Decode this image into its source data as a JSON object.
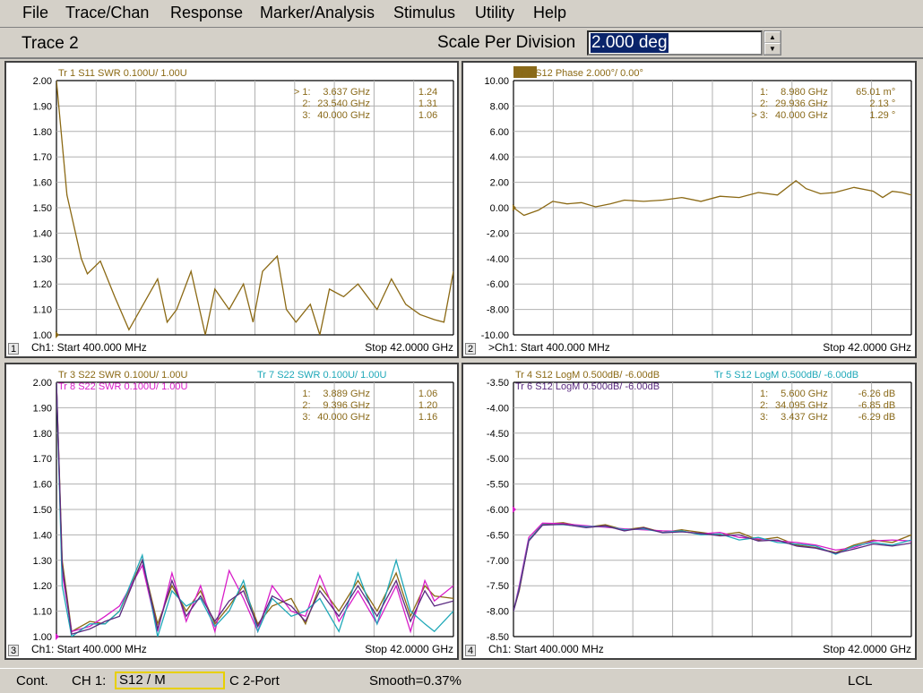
{
  "menu": [
    "File",
    "Trace/Chan",
    "Response",
    "Marker/Analysis",
    "Stimulus",
    "Utility",
    "Help"
  ],
  "entry": {
    "title": "Trace 2",
    "label": "Scale Per Division",
    "value": "2.000 deg",
    "sel": "2.000 deg",
    "spin_up": "▲",
    "spin_down": "▼"
  },
  "colors": {
    "gold": "#8b6914",
    "cyan": "#1ea8b8",
    "magenta": "#d81cc8",
    "purple": "#5a2a80",
    "brown": "#8a6a1a"
  },
  "windows": [
    {
      "id": 1,
      "headers": [
        {
          "text": "Tr  1  S11 SWR 0.100U/  1.00U",
          "color": "gold",
          "boxed": false
        }
      ],
      "yticks": [
        "2.00",
        "1.90",
        "1.80",
        "1.70",
        "1.60",
        "1.50",
        "1.40",
        "1.30",
        "1.20",
        "1.10",
        "1.00"
      ],
      "yrange": [
        1.0,
        2.0
      ],
      "markers_table": [
        [
          "> 1:",
          "3.637 GHz",
          "1.24"
        ],
        [
          "2:",
          "23.540 GHz",
          "1.31"
        ],
        [
          "3:",
          "40.000 GHz",
          "1.06"
        ]
      ],
      "start": "Ch1: Start  400.000 MHz",
      "stop": "Stop  42.0000 GHz",
      "num": "1",
      "chart_data": {
        "type": "line",
        "x_range_ghz": [
          0.4,
          42.0
        ],
        "ylim": [
          1.0,
          2.0
        ],
        "series": [
          {
            "color": "gold",
            "x": [
              0.4,
              1.5,
              3.0,
              3.637,
              5,
              6.5,
              8,
              9.5,
              11,
              12,
              13,
              14.5,
              16,
              17,
              18.5,
              20,
              21,
              22,
              23.54,
              24.5,
              25.5,
              27,
              28,
              29,
              30.5,
              32,
              34,
              35.5,
              37,
              38.5,
              40,
              41,
              42
            ],
            "y": [
              2.0,
              1.55,
              1.3,
              1.24,
              1.29,
              1.15,
              1.02,
              1.12,
              1.22,
              1.05,
              1.1,
              1.25,
              1.0,
              1.18,
              1.1,
              1.2,
              1.05,
              1.25,
              1.31,
              1.1,
              1.05,
              1.12,
              1.0,
              1.18,
              1.15,
              1.2,
              1.1,
              1.22,
              1.12,
              1.08,
              1.06,
              1.05,
              1.25
            ]
          }
        ]
      }
    },
    {
      "id": 2,
      "headers": [
        {
          "text": "Tr  2  S12 Phase 2.000°/  0.00°",
          "color": "gold",
          "boxed": true
        }
      ],
      "yticks": [
        "10.00",
        "8.00",
        "6.00",
        "4.00",
        "2.00",
        "0.00",
        "-2.00",
        "-4.00",
        "-6.00",
        "-8.00",
        "-10.00"
      ],
      "yrange": [
        -10,
        10
      ],
      "markers_table": [
        [
          "1:",
          "8.980 GHz",
          "65.01 m°"
        ],
        [
          "2:",
          "29.936 GHz",
          "2.13 °"
        ],
        [
          "> 3:",
          "40.000 GHz",
          "1.29 °"
        ]
      ],
      "start": ">Ch1: Start  400.000 MHz",
      "stop": "Stop  42.0000 GHz",
      "num": "2",
      "chart_data": {
        "type": "line",
        "x_range_ghz": [
          0.4,
          42.0
        ],
        "ylim": [
          -10,
          10
        ],
        "series": [
          {
            "color": "gold",
            "x": [
              0.4,
              1.5,
              3,
              4.5,
              6,
              7.5,
              8.98,
              10.5,
              12,
              14,
              16,
              18,
              20,
              22,
              24,
              26,
              28,
              29.936,
              31,
              32.5,
              34,
              36,
              38,
              39,
              40,
              41,
              42
            ],
            "y": [
              0.0,
              -0.6,
              -0.2,
              0.5,
              0.3,
              0.4,
              0.07,
              0.3,
              0.6,
              0.5,
              0.6,
              0.8,
              0.5,
              0.9,
              0.8,
              1.2,
              1.0,
              2.13,
              1.5,
              1.1,
              1.2,
              1.6,
              1.3,
              0.8,
              1.29,
              1.2,
              1.0
            ]
          }
        ]
      }
    },
    {
      "id": 3,
      "headers": [
        {
          "text": "Tr  3  S22 SWR 0.100U/  1.00U",
          "color": "gold",
          "boxed": false
        },
        {
          "text": "Tr  8  S22 SWR 0.100U/  1.00U",
          "color": "magenta",
          "boxed": false
        },
        {
          "text": "Tr  7  S22 SWR 0.100U/  1.00U",
          "color": "cyan",
          "boxed": false
        }
      ],
      "yticks": [
        "2.00",
        "1.90",
        "1.80",
        "1.70",
        "1.60",
        "1.50",
        "1.40",
        "1.30",
        "1.20",
        "1.10",
        "1.00"
      ],
      "yrange": [
        1.0,
        2.0
      ],
      "markers_table": [
        [
          "1:",
          "3.889 GHz",
          "1.06"
        ],
        [
          "2:",
          "9.396 GHz",
          "1.20"
        ],
        [
          "3:",
          "40.000 GHz",
          "1.16"
        ]
      ],
      "start": "Ch1: Start  400.000 MHz",
      "stop": "Stop  42.0000 GHz",
      "num": "3",
      "chart_data": {
        "type": "line",
        "x_range_ghz": [
          0.4,
          42.0
        ],
        "ylim": [
          1.0,
          2.0
        ],
        "series": [
          {
            "color": "gold",
            "x": [
              0.4,
              1,
              2,
              3.889,
              5.5,
              7,
              9.396,
              11,
              12.5,
              14,
              15.5,
              17,
              18.5,
              20,
              21.5,
              23,
              25,
              26.5,
              28,
              30,
              32,
              34,
              36,
              37.5,
              39,
              40,
              42
            ],
            "y": [
              2.0,
              1.3,
              1.02,
              1.06,
              1.05,
              1.1,
              1.3,
              1.05,
              1.2,
              1.1,
              1.18,
              1.05,
              1.12,
              1.2,
              1.05,
              1.12,
              1.15,
              1.05,
              1.2,
              1.1,
              1.22,
              1.1,
              1.25,
              1.08,
              1.2,
              1.16,
              1.15
            ]
          },
          {
            "color": "magenta",
            "x": [
              0.4,
              1,
              2,
              3.889,
              5.5,
              7,
              9.396,
              11,
              12.5,
              14,
              15.5,
              17,
              18.5,
              20,
              21.5,
              23,
              25,
              26.5,
              28,
              30,
              32,
              34,
              36,
              37.5,
              39,
              40,
              42
            ],
            "y": [
              2.0,
              1.25,
              1.02,
              1.04,
              1.08,
              1.12,
              1.28,
              1.02,
              1.25,
              1.06,
              1.2,
              1.02,
              1.26,
              1.15,
              1.02,
              1.2,
              1.1,
              1.08,
              1.24,
              1.06,
              1.18,
              1.05,
              1.2,
              1.02,
              1.22,
              1.14,
              1.2
            ]
          },
          {
            "color": "cyan",
            "x": [
              0.4,
              1,
              2,
              3.889,
              5.5,
              7,
              9.396,
              11,
              12.5,
              14,
              15.5,
              17,
              18.5,
              20,
              21.5,
              23,
              25,
              26.5,
              28,
              30,
              32,
              34,
              36,
              37.5,
              39,
              40,
              42
            ],
            "y": [
              2.0,
              1.2,
              1.0,
              1.05,
              1.05,
              1.1,
              1.32,
              1.0,
              1.18,
              1.12,
              1.15,
              1.04,
              1.1,
              1.22,
              1.02,
              1.15,
              1.08,
              1.1,
              1.15,
              1.02,
              1.25,
              1.05,
              1.3,
              1.1,
              1.05,
              1.02,
              1.1
            ]
          },
          {
            "color": "purple",
            "x": [
              0.4,
              1,
              2,
              3.889,
              5.5,
              7,
              9.396,
              11,
              12.5,
              14,
              15.5,
              17,
              18.5,
              20,
              21.5,
              23,
              25,
              26.5,
              28,
              30,
              32,
              34,
              36,
              37.5,
              39,
              40,
              42
            ],
            "y": [
              2.0,
              1.28,
              1.01,
              1.03,
              1.06,
              1.08,
              1.3,
              1.03,
              1.22,
              1.08,
              1.16,
              1.06,
              1.14,
              1.18,
              1.04,
              1.16,
              1.12,
              1.06,
              1.18,
              1.08,
              1.2,
              1.08,
              1.22,
              1.06,
              1.18,
              1.12,
              1.14
            ]
          }
        ]
      }
    },
    {
      "id": 4,
      "headers": [
        {
          "text": "Tr  4  S12 LogM 0.500dB/  -6.00dB",
          "color": "gold",
          "boxed": false
        },
        {
          "text": "Tr  6  S12 LogM 0.500dB/  -6.00dB",
          "color": "purple",
          "boxed": false
        },
        {
          "text": "Tr  5  S12 LogM 0.500dB/  -6.00dB",
          "color": "cyan",
          "boxed": false
        }
      ],
      "yticks": [
        "-3.50",
        "-4.00",
        "-4.50",
        "-5.00",
        "-5.50",
        "-6.00",
        "-6.50",
        "-7.00",
        "-7.50",
        "-8.00",
        "-8.50"
      ],
      "yrange": [
        -8.5,
        -3.5
      ],
      "markers_table": [
        [
          "1:",
          "5.600 GHz",
          "-6.26 dB"
        ],
        [
          "2:",
          "34.095 GHz",
          "-6.85 dB"
        ],
        [
          "3:",
          "3.437 GHz",
          "-6.29 dB"
        ]
      ],
      "start": "Ch1: Start  400.000 MHz",
      "stop": "Stop  42.0000 GHz",
      "num": "4",
      "chart_data": {
        "type": "line",
        "x_range_ghz": [
          0.4,
          42.0
        ],
        "ylim": [
          -8.5,
          -3.5
        ],
        "series": [
          {
            "color": "gold",
            "x": [
              0.4,
              1,
              2,
              3.437,
              5.6,
              8,
              10,
              12,
              14,
              16,
              18,
              20,
              22,
              24,
              26,
              28,
              30,
              32,
              34.095,
              36,
              38,
              40,
              42
            ],
            "y": [
              -8.0,
              -7.6,
              -6.6,
              -6.29,
              -6.26,
              -6.35,
              -6.3,
              -6.4,
              -6.35,
              -6.45,
              -6.4,
              -6.45,
              -6.5,
              -6.45,
              -6.6,
              -6.55,
              -6.7,
              -6.75,
              -6.85,
              -6.7,
              -6.6,
              -6.65,
              -6.5
            ]
          },
          {
            "color": "magenta",
            "x": [
              0.4,
              1,
              2,
              3.437,
              5.6,
              8,
              10,
              12,
              14,
              16,
              18,
              20,
              22,
              24,
              26,
              28,
              30,
              32,
              34.095,
              36,
              38,
              40,
              42
            ],
            "y": [
              -8.0,
              -7.5,
              -6.55,
              -6.27,
              -6.28,
              -6.32,
              -6.35,
              -6.38,
              -6.4,
              -6.42,
              -6.43,
              -6.48,
              -6.45,
              -6.55,
              -6.58,
              -6.62,
              -6.65,
              -6.7,
              -6.8,
              -6.75,
              -6.62,
              -6.6,
              -6.62
            ]
          },
          {
            "color": "cyan",
            "x": [
              0.4,
              1,
              2,
              3.437,
              5.6,
              8,
              10,
              12,
              14,
              16,
              18,
              20,
              22,
              24,
              26,
              28,
              30,
              32,
              34.095,
              36,
              38,
              40,
              42
            ],
            "y": [
              -8.0,
              -7.55,
              -6.6,
              -6.3,
              -6.3,
              -6.34,
              -6.33,
              -6.4,
              -6.38,
              -6.45,
              -6.42,
              -6.5,
              -6.48,
              -6.6,
              -6.55,
              -6.65,
              -6.68,
              -6.72,
              -6.88,
              -6.72,
              -6.65,
              -6.7,
              -6.6
            ]
          },
          {
            "color": "purple",
            "x": [
              0.4,
              1,
              2,
              3.437,
              5.6,
              8,
              10,
              12,
              14,
              16,
              18,
              20,
              22,
              24,
              26,
              28,
              30,
              32,
              34.095,
              36,
              38,
              40,
              42
            ],
            "y": [
              -8.0,
              -7.58,
              -6.62,
              -6.31,
              -6.29,
              -6.36,
              -6.32,
              -6.42,
              -6.36,
              -6.46,
              -6.44,
              -6.47,
              -6.52,
              -6.5,
              -6.62,
              -6.6,
              -6.72,
              -6.76,
              -6.86,
              -6.78,
              -6.68,
              -6.72,
              -6.66
            ]
          }
        ]
      }
    }
  ],
  "statusbar": {
    "cont": "Cont.",
    "ch": "CH 1:",
    "box": "S12 / M",
    "port": "C  2-Port",
    "smooth": "Smooth=0.37%",
    "lcl": "LCL"
  }
}
